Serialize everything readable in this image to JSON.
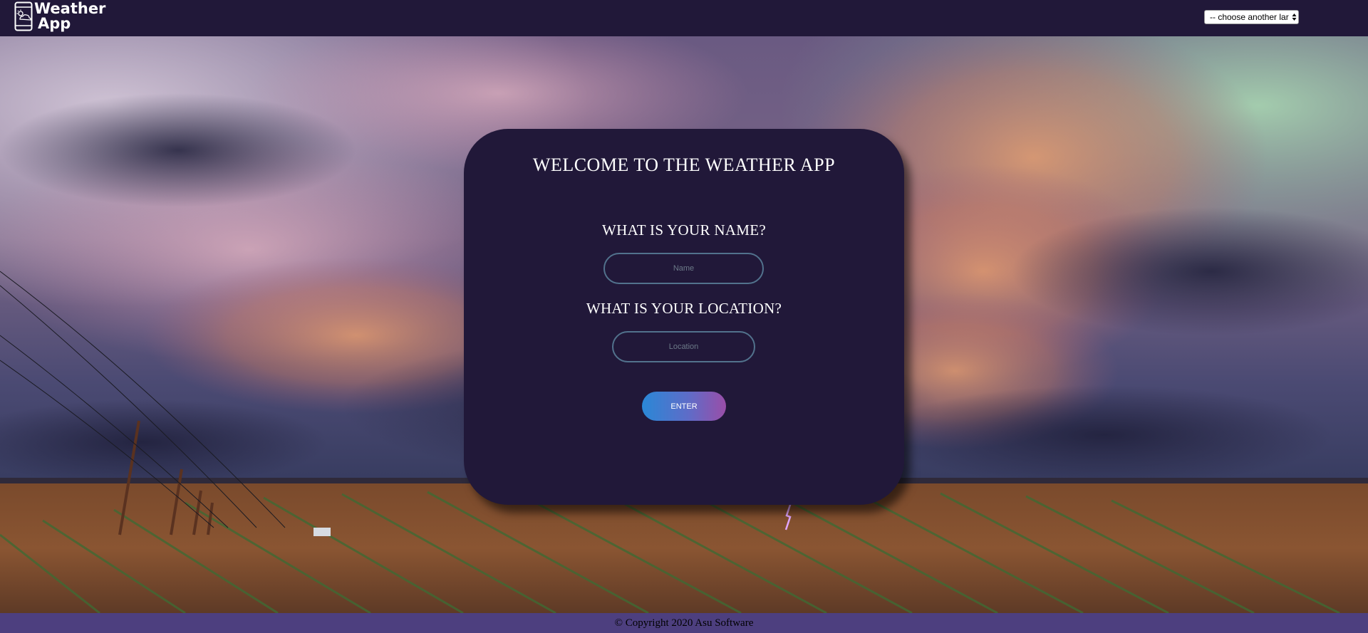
{
  "header": {
    "logo_line1": "Weather",
    "logo_line2": "App",
    "language_select_value": "-- choose another language --",
    "language_select_visible": "-- choose another lar"
  },
  "card": {
    "title": "WELCOME TO THE WEATHER APP",
    "name_question": "WHAT IS YOUR NAME?",
    "name_placeholder": "Name",
    "name_value": "",
    "location_question": "WHAT IS YOUR LOCATION?",
    "location_placeholder": "Location",
    "location_value": "",
    "enter_label": "ENTER"
  },
  "footer": {
    "copyright": "© Copyright 2020 Asu Software"
  },
  "icons": {
    "logo": "phone-weather-icon",
    "select_arrows": "up-down-arrows-icon"
  },
  "colors": {
    "header_bg": "#211839",
    "card_bg": "#211839",
    "input_border": "#52728d",
    "button_gradient_start": "#2a88d6",
    "button_gradient_end": "#9a4ea8",
    "footer_bg": "#4d3f7f"
  }
}
